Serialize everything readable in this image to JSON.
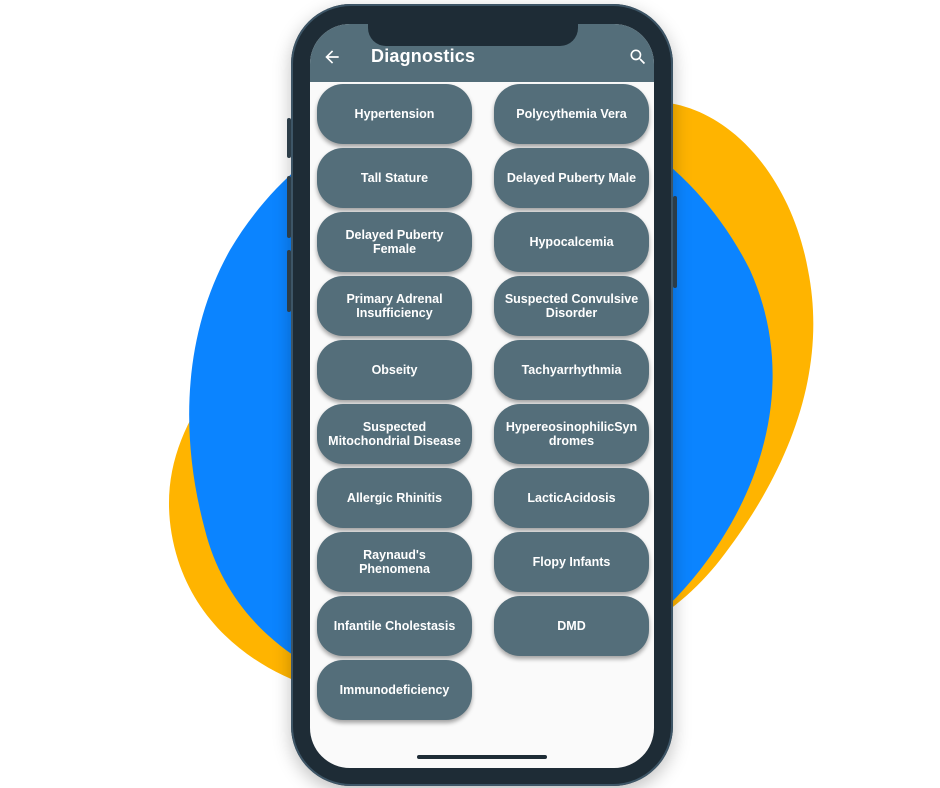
{
  "appbar": {
    "title": "Diagnostics",
    "back_icon": "arrow-left-icon",
    "search_icon": "search-icon",
    "color": "#546e7a"
  },
  "diagnoses": [
    "Hypertension",
    "Polycythemia Vera",
    "Tall Stature",
    "Delayed Puberty Male",
    "Delayed Puberty Female",
    "Hypocalcemia",
    "Primary Adrenal Insufficiency",
    "Suspected Convulsive Disorder",
    "Obseity",
    "Tachyarrhythmia",
    "Suspected Mitochondrial Disease",
    "HypereosinophilicSyndromes",
    "Allergic Rhinitis",
    "LacticAcidosis",
    "Raynaud's Phenomena",
    "Flopy Infants",
    "Infantile Cholestasis",
    "DMD",
    "Immunodeficiency"
  ],
  "colors": {
    "blob_blue": "#0b84ff",
    "blob_yellow": "#ffb400",
    "phone_frame": "#1e2c36",
    "button": "#546e7a",
    "screen_bg": "#fafafa"
  }
}
